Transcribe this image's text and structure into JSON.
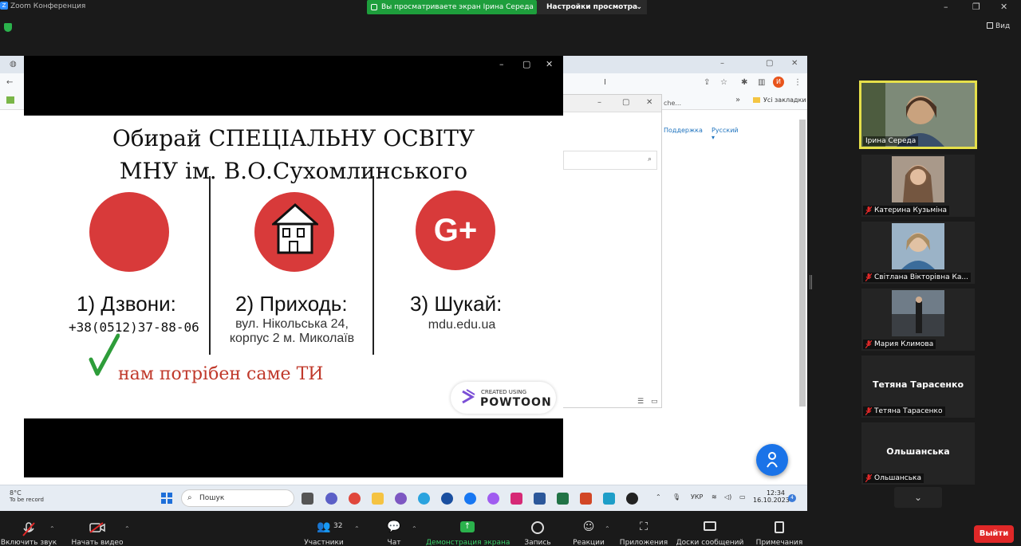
{
  "window": {
    "title": "Zoom Конференция",
    "share_banner": "Вы просматриваете экран Ірина Середа",
    "view_options": "Настройки просмотра",
    "view_button": "Вид"
  },
  "browser": {
    "all_bookmarks": "Усі закладки",
    "bm_partial": "che..."
  },
  "inner_window": {
    "support_link": "Поддержка",
    "language_link": "Русский ▾"
  },
  "slide": {
    "title_line1": "Обирай СПЕЦІАЛЬНУ ОСВІТУ",
    "title_line2": "МНУ ім. В.О.Сухомлинського",
    "col1_heading": "1) Дзвони:",
    "col1_text": "+38(0512)37-88-06",
    "col2_heading": "2) Приходь:",
    "col2_text_line1": "вул. Нікольська 24,",
    "col2_text_line2": "корпус 2 м. Миколаїв",
    "col3_heading": "3) Шукай:",
    "col3_text": "mdu.edu.ua",
    "gplus": "G+",
    "slogan": "нам потрібен саме ТИ",
    "powtoon_small": "CREATED USING",
    "powtoon_big": "POWTOON"
  },
  "taskbar": {
    "weather_temp": "8°C",
    "weather_text": "To be record",
    "search_placeholder": "Пошук",
    "lang": "УКР",
    "time": "12:34",
    "date": "16.10.2023",
    "notif_count": "4",
    "telegram_badge": "3"
  },
  "participants": {
    "active": "Ірина Середа",
    "list": [
      {
        "name": "Катерина Кузьміна",
        "muted": true
      },
      {
        "name": "Світлана Вікторівна Ка...",
        "muted": true
      },
      {
        "name": "Мария Климова",
        "muted": true
      },
      {
        "name": "Тетяна Тарасенко",
        "display_name": "Тетяна Тарасенко",
        "muted": true
      },
      {
        "name": "Ольшанська",
        "display_name": "Ольшанська",
        "muted": true
      }
    ]
  },
  "toolbar": {
    "audio": "Включить звук",
    "video": "Начать видео",
    "participants": "Участники",
    "participants_count": "32",
    "chat": "Чат",
    "share": "Демонстрация экрана",
    "record": "Запись",
    "reactions": "Реакции",
    "apps": "Приложения",
    "whiteboards": "Доски сообщений",
    "notes": "Примечания",
    "exit": "Выйти"
  },
  "colors": {
    "share_green": "#1e9e3c",
    "active_speaker": "#e6e04a",
    "slide_red": "#d83a3a",
    "exit_red": "#e02828"
  }
}
